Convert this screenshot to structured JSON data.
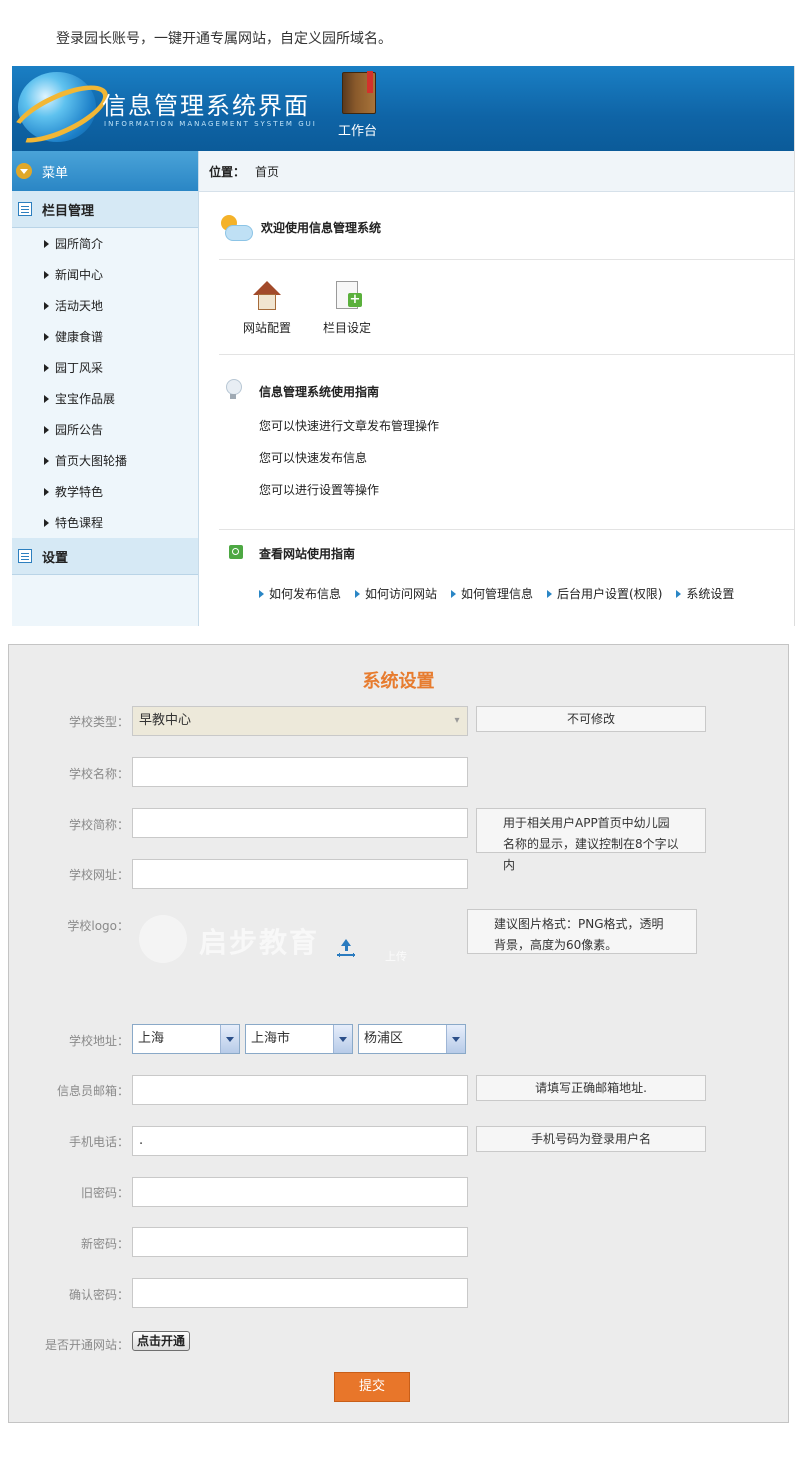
{
  "intro": "登录园长账号，一键开通专属网站，自定义园所域名。",
  "header": {
    "title": "信息管理系统界面",
    "subtitle": "INFORMATION MANAGEMENT SYSTEM GUI",
    "workbench": "工作台"
  },
  "sidebar": {
    "menu_label": "菜单",
    "group_label": "栏目管理",
    "items": [
      "园所简介",
      "新闻中心",
      "活动天地",
      "健康食谱",
      "园丁风采",
      "宝宝作品展",
      "园所公告",
      "首页大图轮播",
      "教学特色",
      "特色课程"
    ],
    "settings_label": "设置"
  },
  "content": {
    "location_label": "位置：",
    "location_value": "首页",
    "welcome": "欢迎使用信息管理系统",
    "quick_links": [
      "网站配置",
      "栏目设定"
    ],
    "guide_title": "信息管理系统使用指南",
    "guide_lines": [
      "您可以快速进行文章发布管理操作",
      "您可以快速发布信息",
      "您可以进行设置等操作"
    ],
    "site_guide_title": "查看网站使用指南",
    "site_guide_links": [
      "如何发布信息",
      "如何访问网站",
      "如何管理信息",
      "后台用户设置(权限)",
      "系统设置"
    ]
  },
  "settings": {
    "title": "系统设置",
    "school_type_label": "学校类型：",
    "school_type_value": "早教中心",
    "school_type_note": "不可修改",
    "school_name_label": "学校名称：",
    "school_name_value": "",
    "short_name_label": "学校简称：",
    "short_name_value": "",
    "short_name_note": "用于相关用户APP首页中幼儿园名称的显示，建议控制在8个字以内",
    "website_label": "学校网址：",
    "website_value": "",
    "logo_label": "学校logo：",
    "logo_watermark": "启步教育",
    "logo_upload_label": "上传",
    "logo_note": "建议图片格式：PNG格式，透明背景，高度为60像素。",
    "address_label": "学校地址：",
    "address_province": "上海",
    "address_city": "上海市",
    "address_district": "杨浦区",
    "email_label": "信息员邮箱：",
    "email_value": "",
    "email_note": "请填写正确邮箱地址.",
    "phone_label": "手机电话：",
    "phone_value": ".",
    "phone_note": "手机号码为登录用户名",
    "old_pwd_label": "旧密码：",
    "new_pwd_label": "新密码：",
    "confirm_pwd_label": "确认密码：",
    "open_site_label": "是否开通网站：",
    "open_site_button": "点击开通",
    "submit_label": "提交"
  }
}
